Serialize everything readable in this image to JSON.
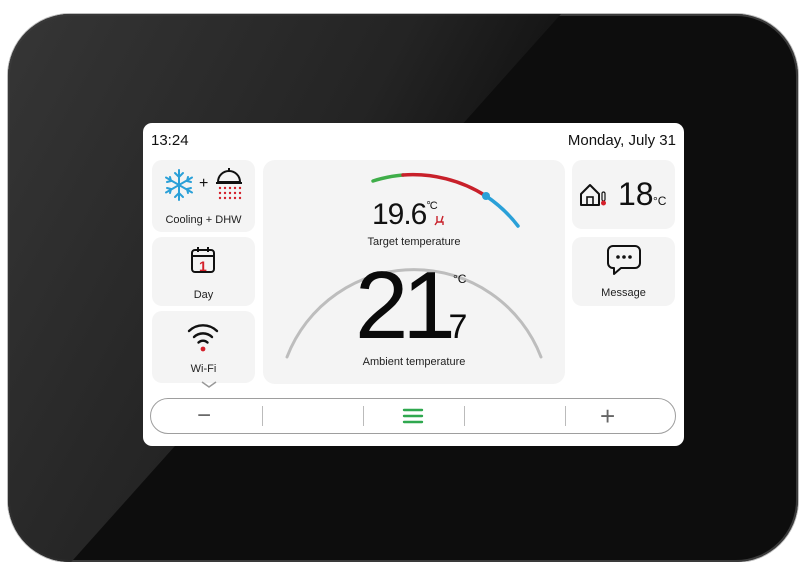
{
  "status_bar": {
    "time": "13:24",
    "date": "Monday, July 31"
  },
  "left_tiles": {
    "mode": {
      "label": "Cooling + DHW",
      "plus": "+"
    },
    "schedule": {
      "day_number": "1",
      "label": "Day"
    },
    "wifi": {
      "label": "Wi-Fi"
    }
  },
  "center": {
    "target_value": "19.6",
    "target_unit": "°C",
    "target_label": "Target temperature",
    "ambient_int": "21",
    "ambient_dec": ".7",
    "ambient_unit": "°C",
    "ambient_label": "Ambient temperature",
    "arc_colors": {
      "track": "#bdbdbd",
      "green": "#3fae49",
      "red": "#c8202a",
      "blue": "#2aa0d8"
    }
  },
  "right_tiles": {
    "outdoor": {
      "value": "18",
      "unit": "°C"
    },
    "message": {
      "label": "Message"
    }
  },
  "bottom_bar": {
    "minus": "−",
    "plus": "+",
    "menu_color": "#2fa84f"
  }
}
